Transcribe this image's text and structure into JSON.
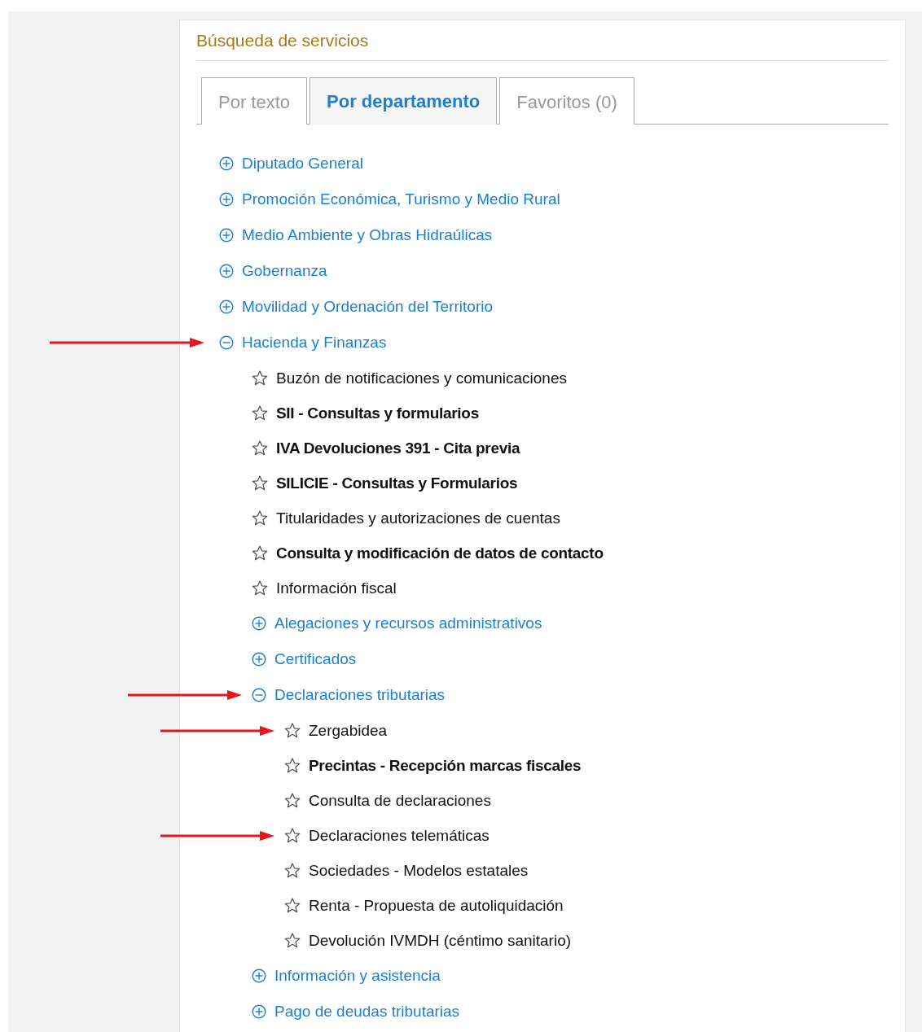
{
  "panel": {
    "title": "Búsqueda de servicios"
  },
  "tabs": [
    {
      "label": "Por texto",
      "selected": false
    },
    {
      "label": "Por departamento",
      "selected": true
    },
    {
      "label": "Favoritos (0)",
      "selected": false
    }
  ],
  "tree": [
    {
      "kind": "group",
      "label": "Diputado General",
      "expanded": false,
      "marked": false
    },
    {
      "kind": "group",
      "label": "Promoción Económica, Turismo y Medio Rural",
      "expanded": false,
      "marked": false
    },
    {
      "kind": "group",
      "label": "Medio Ambiente y Obras Hidraúlicas",
      "expanded": false,
      "marked": false
    },
    {
      "kind": "group",
      "label": "Gobernanza",
      "expanded": false,
      "marked": false
    },
    {
      "kind": "group",
      "label": "Movilidad y Ordenación del Territorio",
      "expanded": false,
      "marked": false
    },
    {
      "kind": "group",
      "label": "Hacienda y Finanzas",
      "expanded": true,
      "marked": true,
      "children": [
        {
          "kind": "service",
          "label": "Buzón de notificaciones y comunicaciones",
          "bold": false,
          "marked": false
        },
        {
          "kind": "service",
          "label": "SII - Consultas y formularios",
          "bold": true,
          "marked": false
        },
        {
          "kind": "service",
          "label": "IVA Devoluciones 391 - Cita previa",
          "bold": true,
          "marked": false
        },
        {
          "kind": "service",
          "label": "SILICIE - Consultas y Formularios",
          "bold": true,
          "marked": false
        },
        {
          "kind": "service",
          "label": "Titularidades y autorizaciones de cuentas",
          "bold": false,
          "marked": false
        },
        {
          "kind": "service",
          "label": "Consulta y modificación de datos de contacto",
          "bold": true,
          "marked": false
        },
        {
          "kind": "service",
          "label": "Información fiscal",
          "bold": false,
          "marked": false
        },
        {
          "kind": "group",
          "label": "Alegaciones y recursos administrativos",
          "expanded": false,
          "marked": false
        },
        {
          "kind": "group",
          "label": "Certificados",
          "expanded": false,
          "marked": false
        },
        {
          "kind": "group",
          "label": "Declaraciones tributarias",
          "expanded": true,
          "marked": true,
          "children": [
            {
              "kind": "service",
              "label": "Zergabidea",
              "bold": false,
              "marked": true
            },
            {
              "kind": "service",
              "label": "Precintas - Recepción marcas fiscales",
              "bold": true,
              "marked": false
            },
            {
              "kind": "service",
              "label": "Consulta de declaraciones",
              "bold": false,
              "marked": false
            },
            {
              "kind": "service",
              "label": "Declaraciones telemáticas",
              "bold": false,
              "marked": true
            },
            {
              "kind": "service",
              "label": "Sociedades - Modelos estatales",
              "bold": false,
              "marked": false
            },
            {
              "kind": "service",
              "label": "Renta - Propuesta de autoliquidación",
              "bold": false,
              "marked": false
            },
            {
              "kind": "service",
              "label": "Devolución IVMDH (céntimo sanitario)",
              "bold": false,
              "marked": false
            }
          ]
        },
        {
          "kind": "group",
          "label": "Información y asistencia",
          "expanded": false,
          "marked": false
        },
        {
          "kind": "group",
          "label": "Pago de deudas tributarias",
          "expanded": false,
          "marked": false
        }
      ]
    }
  ]
}
